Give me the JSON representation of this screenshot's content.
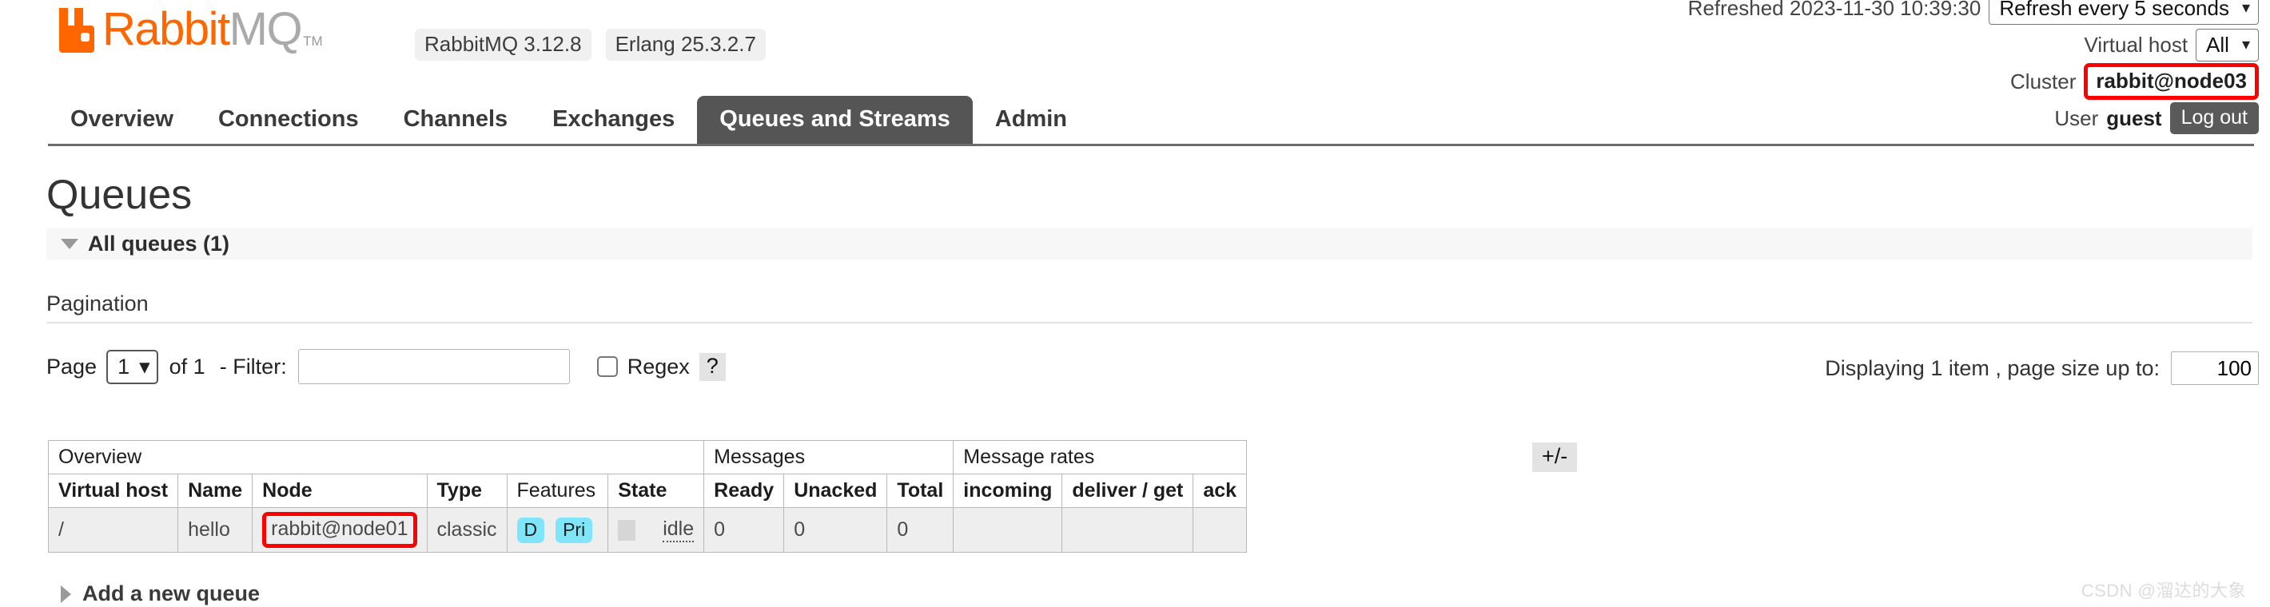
{
  "header": {
    "logo": {
      "icon": "rabbit-logo-icon",
      "word_primary": "Rabbit",
      "word_secondary": "MQ",
      "trademark": "TM",
      "color_primary": "#ff6600",
      "color_secondary": "#aaaaaa"
    },
    "versions": [
      {
        "label": "RabbitMQ 3.12.8"
      },
      {
        "label": "Erlang 25.3.2.7"
      }
    ],
    "refreshed_label": "Refreshed 2023-11-30 10:39:30",
    "refresh_select": {
      "value": "Refresh every 5 seconds",
      "chevron": "chevron-down-icon"
    },
    "vhost_label": "Virtual host",
    "vhost_select": {
      "value": "All",
      "chevron": "chevron-down-icon"
    },
    "cluster_label": "Cluster",
    "cluster_value": "rabbit@node03",
    "cluster_highlight_color": "#ff0000",
    "user_label": "User",
    "user_value": "guest",
    "logout_label": "Log out"
  },
  "nav": {
    "tabs": [
      {
        "label": "Overview",
        "active": false
      },
      {
        "label": "Connections",
        "active": false
      },
      {
        "label": "Channels",
        "active": false
      },
      {
        "label": "Exchanges",
        "active": false
      },
      {
        "label": "Queues and Streams",
        "active": true
      },
      {
        "label": "Admin",
        "active": false
      }
    ]
  },
  "main": {
    "page_title": "Queues",
    "section_title": "All queues (1)",
    "pagination_label": "Pagination",
    "pager": {
      "page_label": "Page",
      "page_value": "1",
      "of_label": "of 1",
      "filter_label": "- Filter:",
      "filter_value": "",
      "regex_label": "Regex",
      "regex_checked": false,
      "help_label": "?"
    },
    "displaying": {
      "text": "Displaying 1 item , page size up to:",
      "page_size": "100"
    },
    "plus_minus_label": "+/-",
    "add_queue_label": "Add a new queue"
  },
  "table": {
    "group_headers": [
      {
        "label": "Overview",
        "colspan": 6
      },
      {
        "label": "Messages",
        "colspan": 3
      },
      {
        "label": "Message rates",
        "colspan": 3
      }
    ],
    "columns": [
      {
        "label": "Virtual host",
        "bold": true,
        "align": "left"
      },
      {
        "label": "Name",
        "bold": true,
        "align": "left"
      },
      {
        "label": "Node",
        "bold": true,
        "align": "left"
      },
      {
        "label": "Type",
        "bold": true,
        "align": "left"
      },
      {
        "label": "Features",
        "bold": false,
        "align": "left"
      },
      {
        "label": "State",
        "bold": true,
        "align": "left"
      },
      {
        "label": "Ready",
        "bold": true,
        "align": "right"
      },
      {
        "label": "Unacked",
        "bold": true,
        "align": "right"
      },
      {
        "label": "Total",
        "bold": true,
        "align": "right"
      },
      {
        "label": "incoming",
        "bold": true,
        "align": "left"
      },
      {
        "label": "deliver / get",
        "bold": true,
        "align": "left"
      },
      {
        "label": "ack",
        "bold": true,
        "align": "left"
      }
    ],
    "rows": [
      {
        "vhost": "/",
        "name": "hello",
        "node": "rabbit@node01",
        "node_highlighted": true,
        "type": "classic",
        "features": [
          "D",
          "Pri"
        ],
        "feature_color": "#7fe6fa",
        "state": "idle",
        "ready": "0",
        "unacked": "0",
        "total": "0",
        "incoming": "",
        "deliver_get": "",
        "ack": ""
      }
    ]
  },
  "watermark": "CSDN @溜达的大象"
}
